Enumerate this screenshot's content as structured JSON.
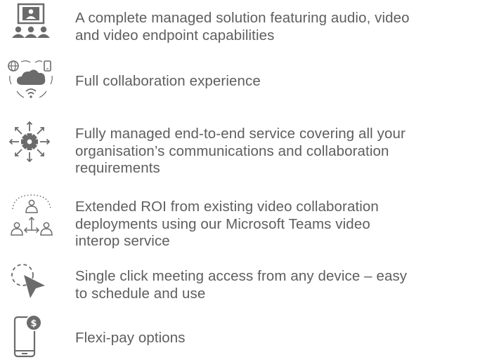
{
  "features": [
    {
      "icon": "video-meeting-icon",
      "lines": [
        "A complete managed solution featuring audio, video",
        "and video endpoint capabilities"
      ]
    },
    {
      "icon": "cloud-devices-icon",
      "lines": [
        "Full collaboration experience"
      ]
    },
    {
      "icon": "managed-service-gear-icon",
      "lines": [
        "Fully managed end-to-end service covering all your",
        "organisation’s communications and collaboration",
        "requirements"
      ]
    },
    {
      "icon": "interop-people-icon",
      "lines": [
        "Extended ROI from existing video collaboration",
        "deployments using our Microsoft Teams video",
        "interop service"
      ]
    },
    {
      "icon": "cursor-click-icon",
      "lines": [
        "Single click meeting access from any device – easy",
        "to schedule and use"
      ]
    },
    {
      "icon": "mobile-payment-icon",
      "lines": [
        "Flexi-pay options"
      ]
    }
  ],
  "colors": {
    "text": "#5e5e5e",
    "icon": "#6b6b6b"
  }
}
